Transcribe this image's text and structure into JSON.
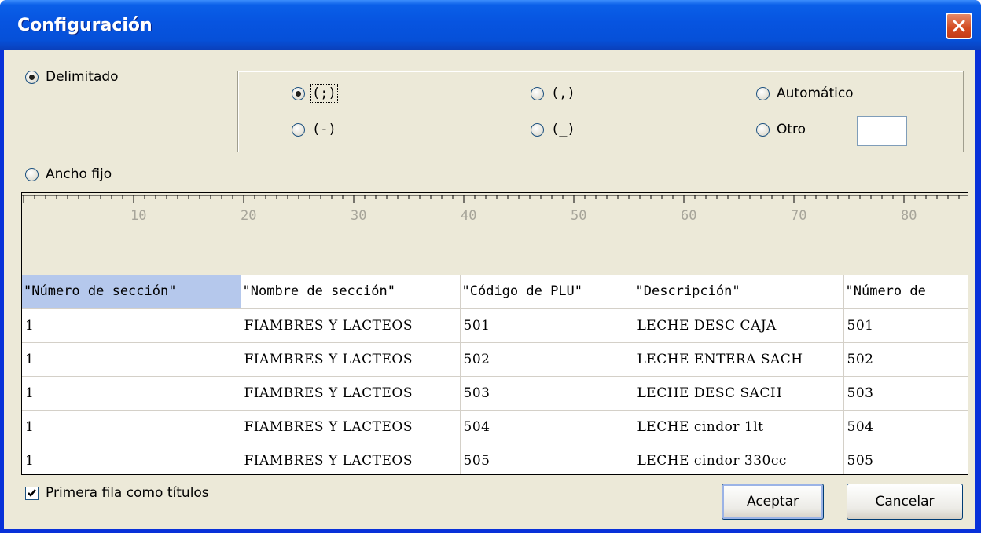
{
  "window": {
    "title": "Configuración"
  },
  "mode": {
    "delimited_label": "Delimitado",
    "fixed_label": "Ancho fijo",
    "selected": "Delimitado"
  },
  "delimiters": {
    "semicolon": "(;)",
    "comma": "(,)",
    "automatic": "Automático",
    "hyphen": "(-)",
    "underscore": "(_)",
    "other": "Otro",
    "other_value": "",
    "selected": "(;)"
  },
  "ruler": {
    "labels": [
      "10",
      "20",
      "30",
      "40",
      "50",
      "60",
      "70",
      "80"
    ]
  },
  "preview": {
    "headers": [
      "\"Número de sección\"",
      "\"Nombre de sección\"",
      "\"Código de PLU\"",
      "\"Descripción\"",
      "\"Número de"
    ],
    "rows": [
      [
        "1",
        "FIAMBRES Y LACTEOS",
        "501",
        "LECHE DESC CAJA",
        "501"
      ],
      [
        "1",
        "FIAMBRES Y LACTEOS",
        "502",
        "LECHE ENTERA SACH",
        "502"
      ],
      [
        "1",
        "FIAMBRES Y LACTEOS",
        "503",
        "LECHE DESC SACH",
        "503"
      ],
      [
        "1",
        "FIAMBRES Y LACTEOS",
        "504",
        "LECHE cindor 1lt",
        "504"
      ],
      [
        "1",
        "FIAMBRES Y LACTEOS",
        "505",
        "LECHE cindor 330cc",
        "505"
      ]
    ]
  },
  "options": {
    "first_row_titles_label": "Primera fila como títulos",
    "first_row_titles_checked": true
  },
  "buttons": {
    "accept": "Aceptar",
    "cancel": "Cancelar"
  },
  "colors": {
    "title_bar": "#0654dc",
    "dialog_bg": "#ece9d8",
    "header_selected": "#b5c8ec",
    "close_button": "#d34a20"
  }
}
